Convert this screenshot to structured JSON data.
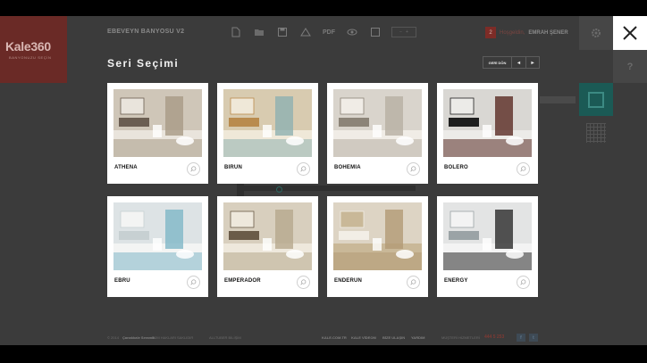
{
  "header": {
    "logo_brand": "Kale360",
    "logo_sub": "BANYONUZU SEÇİN",
    "project_title": "EBEVEYN BANYOSU V2",
    "toolbar_pdf": "PDF",
    "user_badge": "2",
    "user_greeting": "Hoşgeldin,",
    "user_name": "EMRAH ŞENER",
    "help_label": "?"
  },
  "modal": {
    "title": "Seri Seçimi",
    "back_label": "GERİ DÖN",
    "prev_label": "◂",
    "next_label": "▸",
    "series": [
      {
        "name": "ATHENA",
        "palette": [
          "#cfc6b8",
          "#a89a86",
          "#6b5e52",
          "#e9e4dc"
        ]
      },
      {
        "name": "BIRUN",
        "palette": [
          "#d8cbb0",
          "#8fb0b1",
          "#b98b4e",
          "#efe8d8"
        ]
      },
      {
        "name": "BOHEMIA",
        "palette": [
          "#d9d4cc",
          "#b7afa3",
          "#8c8478",
          "#f0ece6"
        ]
      },
      {
        "name": "BOLERO",
        "palette": [
          "#d9d7d3",
          "#5a2c24",
          "#1e1e1e",
          "#ecebe8"
        ]
      },
      {
        "name": "EBRU",
        "palette": [
          "#dde3e5",
          "#7fb6c7",
          "#c7d0d2",
          "#f3f4f3"
        ]
      },
      {
        "name": "EMPERADOR",
        "palette": [
          "#d8cfbe",
          "#b6a78d",
          "#6a5b48",
          "#eee8dc"
        ]
      },
      {
        "name": "ENDERUN",
        "palette": [
          "#ddd4c4",
          "#b39a76",
          "#f2eee6",
          "#c9b898"
        ]
      },
      {
        "name": "ENERGY",
        "palette": [
          "#e3e4e4",
          "#2a2a2a",
          "#9ba3a6",
          "#f3f3f3"
        ]
      }
    ]
  },
  "footer": {
    "copyright": "© 2014",
    "company": "Çanakkale Seramik",
    "rights": "TÜM HAKLARI SAKLIDIR",
    "rights2": "ALLTUBER BİLİŞİM",
    "link1": "KALE.COM.TR",
    "link2": "KALE VİDEOM",
    "link3": "BİZE ULAŞIN",
    "link4": "YARDIM",
    "service_label": "MÜŞTERİ HİZMETLERİ",
    "phone": "444 5 253",
    "facebook": "f",
    "twitter": "t"
  }
}
